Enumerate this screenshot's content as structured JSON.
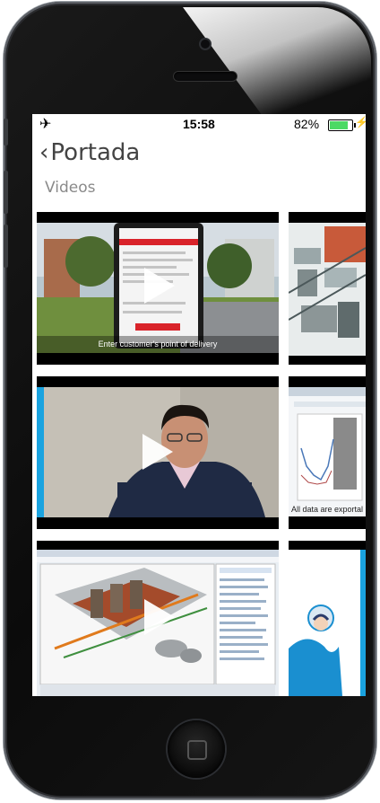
{
  "status_bar": {
    "time": "15:58",
    "battery_percent": "82%",
    "battery_level": 0.82
  },
  "nav": {
    "back_label": "Portada"
  },
  "page": {
    "title": "Videos"
  },
  "videos": [
    {
      "caption": "Enter customer's point of delivery"
    },
    {
      "caption": ""
    },
    {
      "caption": ""
    },
    {
      "caption": "All data are exportal"
    },
    {
      "caption": ""
    },
    {
      "caption": ""
    }
  ],
  "colors": {
    "accent_red": "#d9232a",
    "battery_green": "#4cd964",
    "sidebar_blue": "#1aa3e0"
  }
}
